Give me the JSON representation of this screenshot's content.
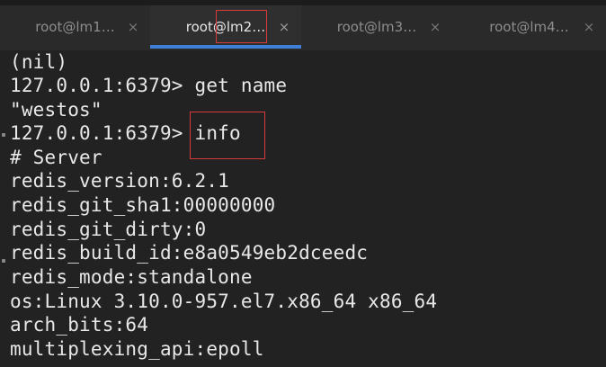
{
  "tabs": [
    {
      "label": "root@lm1…",
      "close": "×",
      "active": false
    },
    {
      "label": "root@lm2…",
      "close": "×",
      "active": true
    },
    {
      "label": "root@lm3…",
      "close": "×",
      "active": false
    },
    {
      "label": "root@lm4…",
      "close": "×",
      "active": false
    }
  ],
  "terminal": {
    "lines": [
      "(nil)",
      "127.0.0.1:6379> get name",
      "\"westos\"",
      "127.0.0.1:6379> info",
      "# Server",
      "redis_version:6.2.1",
      "redis_git_sha1:00000000",
      "redis_git_dirty:0",
      "redis_build_id:e8a0549eb2dceedc",
      "redis_mode:standalone",
      "os:Linux 3.10.0-957.el7.x86_64 x86_64",
      "arch_bits:64",
      "multiplexing_api:epoll"
    ]
  },
  "colors": {
    "background": "#222222",
    "text": "#e8e8e8",
    "tab_active_underline": "#3f7fd6",
    "annotation_box": "#d63a3a"
  }
}
